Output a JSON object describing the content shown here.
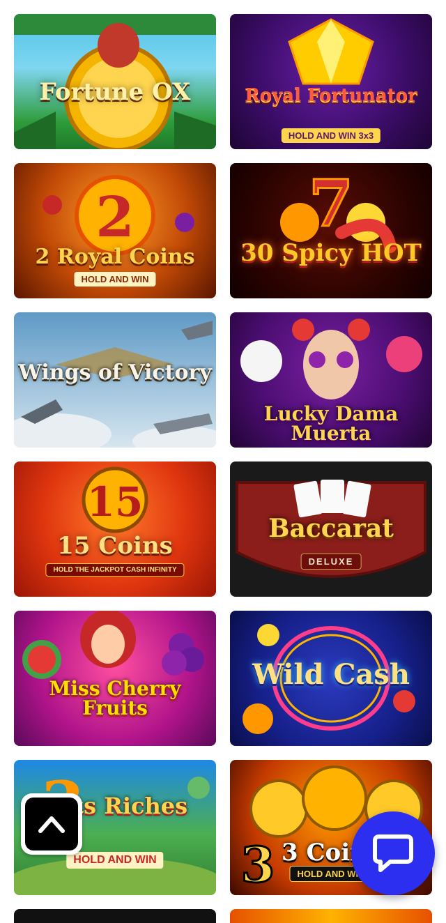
{
  "games": [
    {
      "id": "fortune-ox",
      "title": "Fortune OX",
      "subtitle": ""
    },
    {
      "id": "royal-fortunator",
      "title": "Royal Fortunator",
      "subtitle": "HOLD AND WIN 3x3"
    },
    {
      "id": "royal-coins-2",
      "title": "2 Royal Coins",
      "subtitle": "HOLD AND WIN"
    },
    {
      "id": "spicy-hot-30",
      "title": "30 Spicy HOT",
      "subtitle": ""
    },
    {
      "id": "wings-of-victory",
      "title": "Wings of Victory",
      "subtitle": ""
    },
    {
      "id": "lucky-dama-muerta",
      "title": "Lucky Dama Muerta",
      "subtitle": ""
    },
    {
      "id": "15-coins",
      "title": "15 Coins",
      "subtitle": "HOLD THE JACKPOT CASH INFINITY"
    },
    {
      "id": "baccarat-deluxe",
      "title": "Baccarat",
      "subtitle": "DELUXE"
    },
    {
      "id": "miss-cherry-fruits",
      "title": "Miss Cherry Fruits",
      "subtitle": ""
    },
    {
      "id": "wild-cash",
      "title": "Wild Cash",
      "subtitle": ""
    },
    {
      "id": "3-pots-riches",
      "title": "Pots Riches",
      "subtitle": "HOLD AND WIN"
    },
    {
      "id": "3-coins",
      "title": "3 Coins",
      "subtitle": "HOLD AND WIN"
    }
  ],
  "controls": {
    "scroll_top_icon": "chevron-up-icon",
    "chat_icon": "chat-bubble-icon"
  },
  "colors": {
    "chat_button": "#2d2ff0",
    "scroll_button": "#000000"
  }
}
